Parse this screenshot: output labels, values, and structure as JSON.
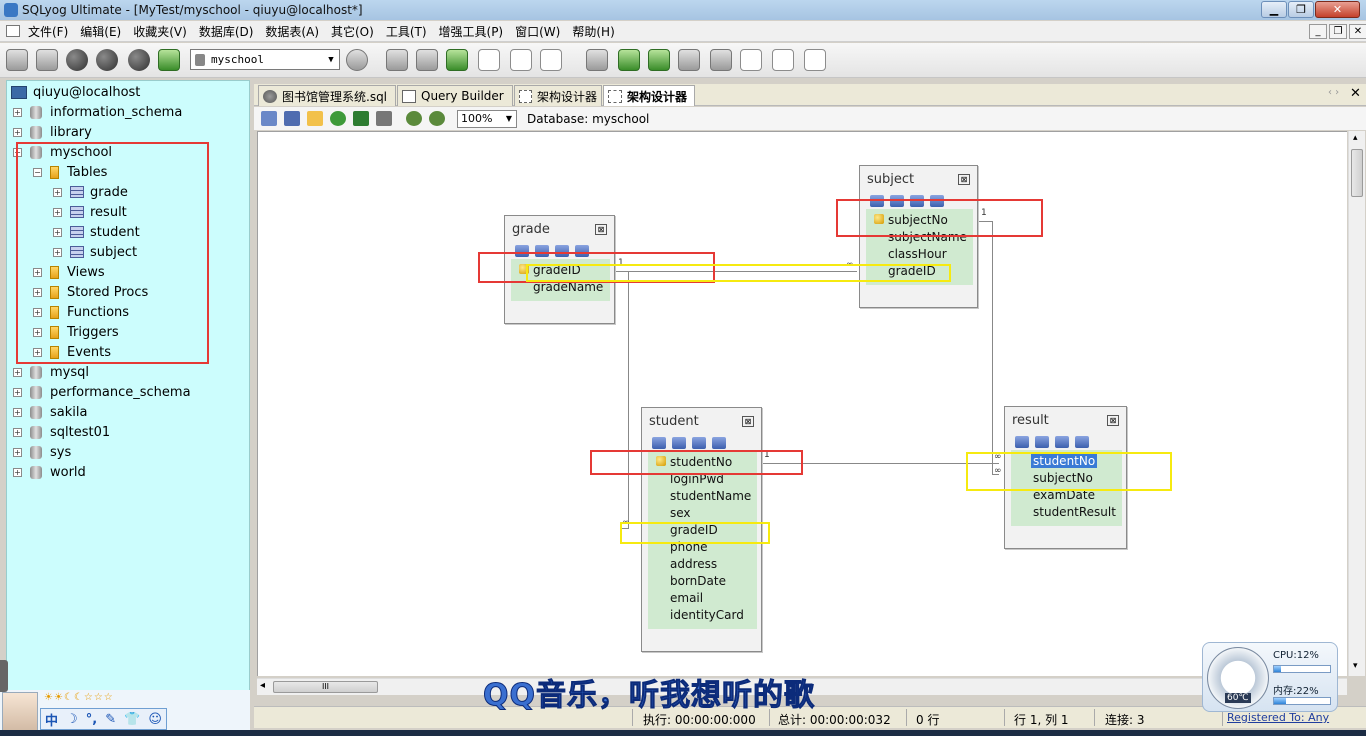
{
  "window": {
    "title": "SQLyog Ultimate - [MyTest/myschool - qiuyu@localhost*]",
    "min": "▁",
    "max": "❐",
    "close": "✕"
  },
  "menu": [
    "文件(F)",
    "编辑(E)",
    "收藏夹(V)",
    "数据库(D)",
    "数据表(A)",
    "其它(O)",
    "工具(T)",
    "增强工具(P)",
    "窗口(W)",
    "帮助(H)"
  ],
  "mdi": {
    "min": "_",
    "restore": "❐",
    "close": "✕"
  },
  "toolbar": {
    "database": "myschool",
    "dropdown_arrow": "▼"
  },
  "tree": {
    "host": "qiuyu@localhost",
    "collapsed": "+",
    "expanded": "−",
    "databases_before": [
      "information_schema",
      "library"
    ],
    "expanded_db": "myschool",
    "tables_folder": "Tables",
    "tables": [
      "grade",
      "result",
      "student",
      "subject"
    ],
    "folders": [
      "Views",
      "Stored Procs",
      "Functions",
      "Triggers",
      "Events"
    ],
    "databases_after": [
      "mysql",
      "performance_schema",
      "sakila",
      "sqltest01",
      "sys",
      "world"
    ]
  },
  "tabs": [
    "图书馆管理系统.sql",
    "Query Builder",
    "架构设计器",
    "架构设计器"
  ],
  "tab_nav": "‹ ›",
  "tab_close": "✕",
  "schema_toolbar": {
    "zoom": "100%",
    "zoom_arrow": "▼",
    "database_label": "Database: myschool"
  },
  "er": {
    "close_glyph": "⊠",
    "one": "1",
    "many": "∞",
    "grade": {
      "title": "grade",
      "columns": [
        "gradeID",
        "gradeName"
      ],
      "key": "gradeID"
    },
    "subject": {
      "title": "subject",
      "columns": [
        "subjectNo",
        "subjectName",
        "classHour",
        "gradeID"
      ],
      "key": "subjectNo"
    },
    "student": {
      "title": "student",
      "columns": [
        "studentNo",
        "loginPwd",
        "studentName",
        "sex",
        "gradeID",
        "phone",
        "address",
        "bornDate",
        "email",
        "identityCard"
      ],
      "key": "studentNo"
    },
    "result": {
      "title": "result",
      "columns": [
        "studentNo",
        "subjectNo",
        "examDate",
        "studentResult"
      ],
      "selected": "studentNo"
    }
  },
  "scroll": {
    "thumb_grip": "III",
    "left_arrow": "◂",
    "up_arrow": "▴",
    "down_arrow": "▾"
  },
  "status": {
    "exec": "执行: 00:00:00:000",
    "total": "总计: 00:00:00:032",
    "rows": "0 行",
    "position": "行 1, 列 1",
    "connections": "连接: 3",
    "registered": "Registered To: Any"
  },
  "overlay": {
    "lyrics": "QQ音乐，听我想听的歌",
    "cpu": "CPU:12%",
    "cpu_value": 12,
    "memory": "内存:22%",
    "memory_value": 22,
    "temperature": "60℃"
  },
  "ime": {
    "lang": "中",
    "moon": "☽",
    "punct": "°,",
    "tool": "✎",
    "skin": "👕",
    "smile": "☺"
  },
  "suns": "☀☀☾☾☆☆☆"
}
